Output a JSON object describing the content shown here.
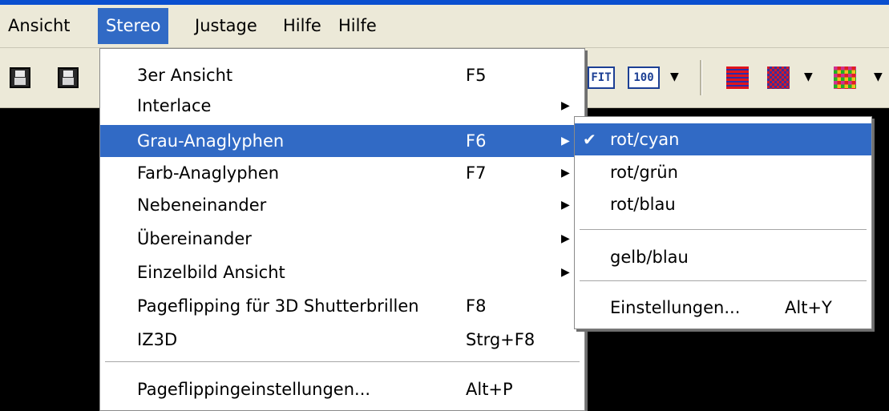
{
  "colors": {
    "menu_highlight": "#316ac5",
    "menubar_bg": "#ece9d8",
    "workspace_bg": "#000000",
    "title_strip": "#0a4fcf"
  },
  "menubar": {
    "items": [
      {
        "label": "Ansicht"
      },
      {
        "label": "Stereo"
      },
      {
        "label": "Justage"
      },
      {
        "label": "Hilfe"
      },
      {
        "label": "Hilfe"
      }
    ],
    "active_index": 1
  },
  "toolbar": {
    "buttons": [
      {
        "icon": "save-icon"
      },
      {
        "icon": "save-all-icon"
      },
      {
        "icon": "fit-icon",
        "label": "FIT"
      },
      {
        "icon": "zoom-100-icon",
        "label": "100"
      },
      {
        "icon": "chevron-down-icon"
      },
      {
        "icon": "interlace-pattern-icon"
      },
      {
        "icon": "checker-pattern-icon"
      },
      {
        "icon": "chevron-down-icon"
      },
      {
        "icon": "color-pattern-icon"
      },
      {
        "icon": "chevron-down-icon"
      }
    ]
  },
  "stereo_menu": {
    "items": [
      {
        "label": "3er Ansicht",
        "accel": "F5",
        "submenu": false
      },
      {
        "label": "Interlace",
        "accel": "",
        "submenu": true
      },
      {
        "label": "Grau-Anaglyphen",
        "accel": "F6",
        "submenu": true,
        "highlighted": true
      },
      {
        "label": "Farb-Anaglyphen",
        "accel": "F7",
        "submenu": true
      },
      {
        "label": "Nebeneinander",
        "accel": "",
        "submenu": true
      },
      {
        "label": "Übereinander",
        "accel": "",
        "submenu": true
      },
      {
        "label": "Einzelbild Ansicht",
        "accel": "",
        "submenu": true
      },
      {
        "label": "Pageflipping für 3D Shutterbrillen",
        "accel": "F8",
        "submenu": false
      },
      {
        "label": "IZ3D",
        "accel": "Strg+F8",
        "submenu": false
      },
      {
        "label": "Pageflippingeinstellungen...",
        "accel": "Alt+P",
        "submenu": false
      }
    ]
  },
  "anaglyph_submenu": {
    "items": [
      {
        "label": "rot/cyan",
        "checked": true,
        "highlighted": true,
        "accel": ""
      },
      {
        "label": "rot/grün",
        "checked": false,
        "accel": ""
      },
      {
        "label": "rot/blau",
        "checked": false,
        "accel": ""
      },
      {
        "label": "gelb/blau",
        "checked": false,
        "accel": ""
      },
      {
        "label": "Einstellungen...",
        "checked": false,
        "accel": "Alt+Y"
      }
    ]
  }
}
